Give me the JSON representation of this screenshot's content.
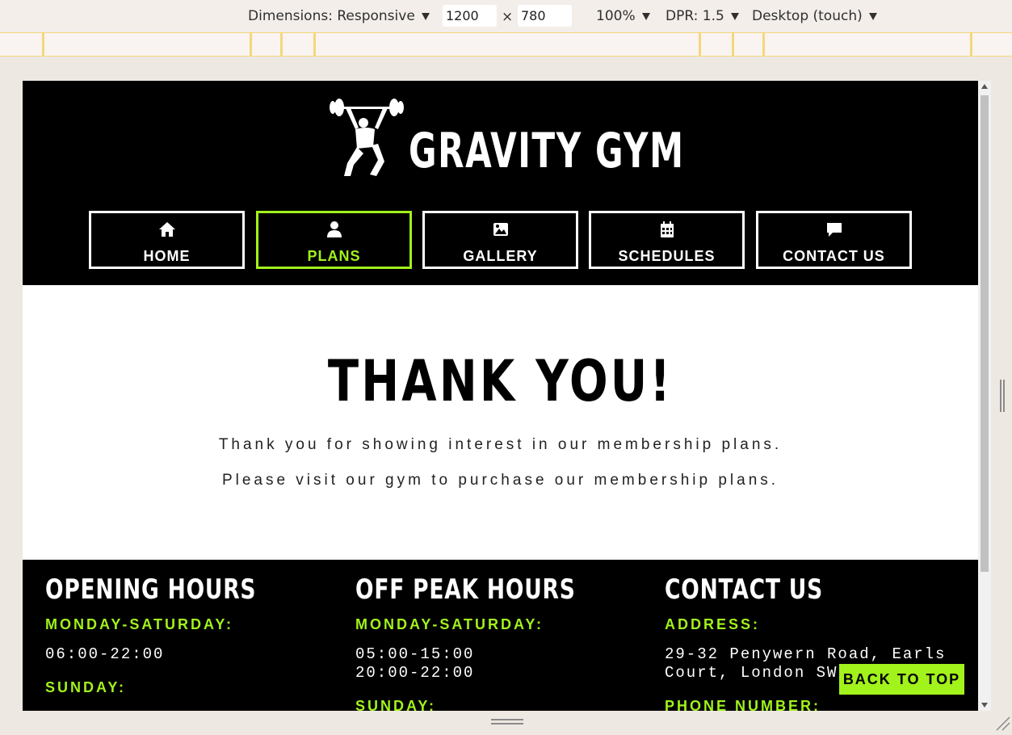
{
  "devtools": {
    "dimensions_label": "Dimensions: Responsive",
    "width": "1200",
    "times": "×",
    "height": "780",
    "zoom": "100%",
    "dpr": "DPR: 1.5",
    "device": "Desktop (touch)"
  },
  "site": {
    "brand": "GRAVITY GYM",
    "accent_color": "#a2f21b",
    "nav": [
      {
        "label": "HOME",
        "icon": "home-icon"
      },
      {
        "label": "PLANS",
        "icon": "user-icon",
        "active": true
      },
      {
        "label": "GALLERY",
        "icon": "image-icon"
      },
      {
        "label": "SCHEDULES",
        "icon": "calendar-icon"
      },
      {
        "label": "CONTACT US",
        "icon": "chat-icon"
      }
    ]
  },
  "main": {
    "heading": "THANK YOU!",
    "line1": "Thank you for showing interest in our membership plans.",
    "line2": "Please visit our gym to purchase our membership plans."
  },
  "footer": {
    "opening": {
      "title": "OPENING HOURS",
      "label1": "MONDAY-SATURDAY:",
      "value1": "06:00-22:00",
      "label2": "SUNDAY:"
    },
    "offpeak": {
      "title": "OFF PEAK HOURS",
      "label1": "MONDAY-SATURDAY:",
      "value1a": "05:00-15:00",
      "value1b": "20:00-22:00",
      "label2": "SUNDAY:"
    },
    "contact": {
      "title": "CONTACT US",
      "label1": "ADDRESS:",
      "value1a": "29-32 Penywern Road, Earls",
      "value1b": "Court, London SW",
      "label2": "PHONE NUMBER:"
    }
  },
  "back_to_top": "BACK TO TOP"
}
